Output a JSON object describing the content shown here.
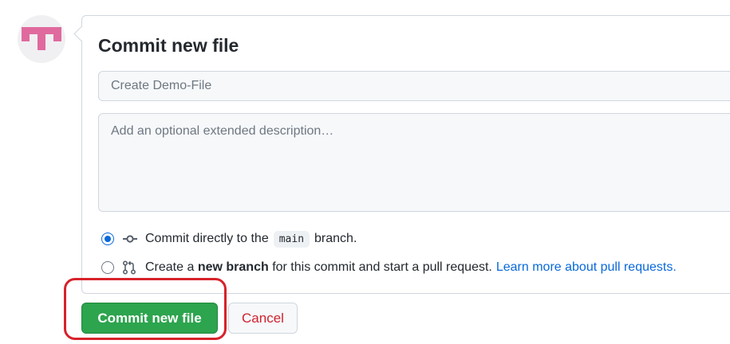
{
  "avatar": {
    "icon": "identicon"
  },
  "form": {
    "title": "Commit new file",
    "summary_placeholder": "Create Demo-File",
    "description_placeholder": "Add an optional extended description…"
  },
  "options": {
    "direct": {
      "checked": true,
      "text_before": "Commit directly to the",
      "branch": "main",
      "text_after": "branch.",
      "icon": "git-commit-icon"
    },
    "new_branch": {
      "checked": false,
      "text_before": "Create a",
      "bold": "new branch",
      "text_after": "for this commit and start a pull request.",
      "link": "Learn more about pull requests.",
      "icon": "git-pull-request-icon"
    }
  },
  "buttons": {
    "commit": "Commit new file",
    "cancel": "Cancel"
  },
  "colors": {
    "commit_button": "#2da44e",
    "cancel_text": "#cf222e",
    "link": "#0969da",
    "highlight": "#d7222a"
  }
}
